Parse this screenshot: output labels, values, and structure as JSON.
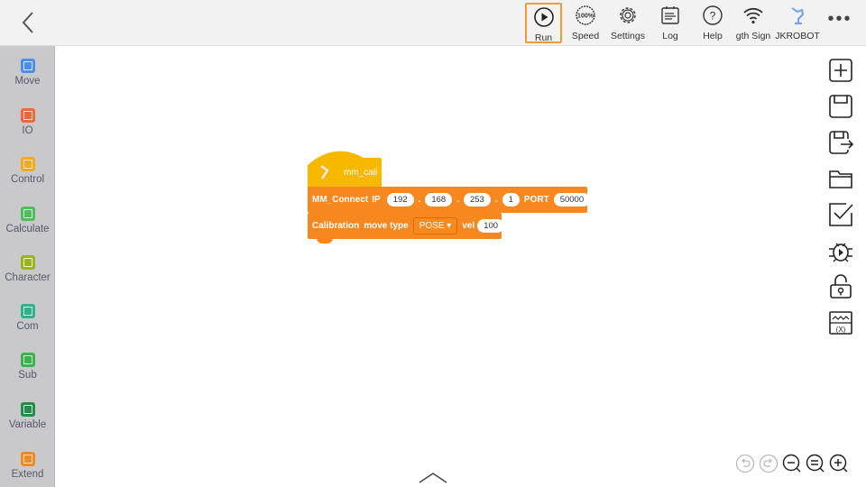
{
  "toolbar": {
    "items": [
      {
        "label": "Run",
        "icon": "play-icon"
      },
      {
        "label": "Speed",
        "icon": "speed-icon"
      },
      {
        "label": "Settings",
        "icon": "gear-icon"
      },
      {
        "label": "Log",
        "icon": "log-icon"
      },
      {
        "label": "Help",
        "icon": "help-icon"
      },
      {
        "label": "gth  Sign",
        "icon": "wifi-icon"
      },
      {
        "label": "JKROBOT",
        "icon": "robot-arm-icon"
      }
    ],
    "active": "Run",
    "speed_icon_text": "100%"
  },
  "sidebar": {
    "items": [
      {
        "label": "Move",
        "color": "#4a8ef0"
      },
      {
        "label": "IO",
        "color": "#f0673a"
      },
      {
        "label": "Control",
        "color": "#f9a81c"
      },
      {
        "label": "Calculate",
        "color": "#4cbf5a"
      },
      {
        "label": "Character",
        "color": "#9cb41c"
      },
      {
        "label": "Com",
        "color": "#2db38a"
      },
      {
        "label": "Sub",
        "color": "#37b54a"
      },
      {
        "label": "Variable",
        "color": "#1e8f48"
      },
      {
        "label": "Extend",
        "color": "#f7881f"
      }
    ]
  },
  "blocks": {
    "hat": {
      "label": "mm_cali",
      "color": "#f9b800"
    },
    "connect": {
      "label": "MM_Connect",
      "ip_label": "IP",
      "ip": [
        "192",
        "168",
        "253",
        "1"
      ],
      "port_label": "PORT",
      "port": "50000",
      "color": "#f7881f"
    },
    "calibration": {
      "label": "Calibration",
      "move_type_label": "move type",
      "move_type": "POSE",
      "vel_label": "vel",
      "vel": "100",
      "color": "#f7881f"
    }
  },
  "right_tools": [
    "add-icon",
    "save-icon",
    "save-as-icon",
    "open-folder-icon",
    "checklist-icon",
    "debug-icon",
    "lock-icon",
    "variable-monitor-icon"
  ],
  "zoom_controls": [
    "undo",
    "redo",
    "zoom-out",
    "reset-zoom",
    "zoom-in"
  ]
}
